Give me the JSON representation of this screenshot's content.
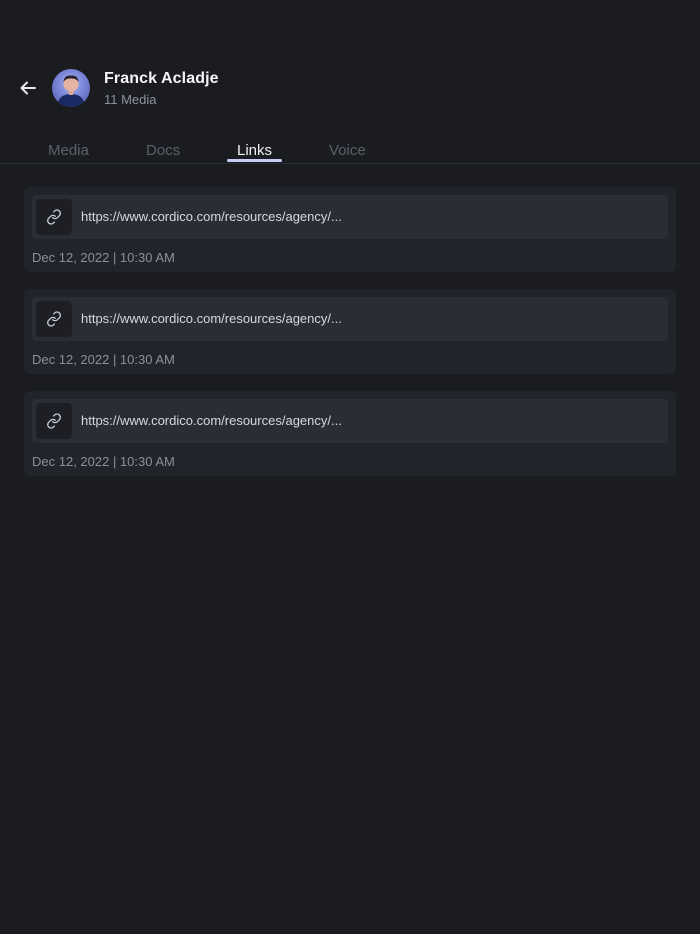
{
  "header": {
    "contact_name": "Franck Acladje",
    "media_count": "11 Media"
  },
  "tabs": [
    {
      "label": "Media",
      "active": false
    },
    {
      "label": "Docs",
      "active": false
    },
    {
      "label": "Links",
      "active": true
    },
    {
      "label": "Voice",
      "active": false
    }
  ],
  "links": [
    {
      "url": "https://www.cordico.com/resources/agency/...",
      "date": "Dec 12, 2022 | 10:30 AM"
    },
    {
      "url": "https://www.cordico.com/resources/agency/...",
      "date": "Dec 12, 2022 | 10:30 AM"
    },
    {
      "url": "https://www.cordico.com/resources/agency/...",
      "date": "Dec 12, 2022 | 10:30 AM"
    }
  ],
  "colors": {
    "background": "#1b1c20",
    "card": "#22242b",
    "link_row": "#2b2d36",
    "active_tab_underline": "#c5cdf6"
  },
  "icons": {
    "back": "arrow-left-icon",
    "link": "link-icon"
  }
}
